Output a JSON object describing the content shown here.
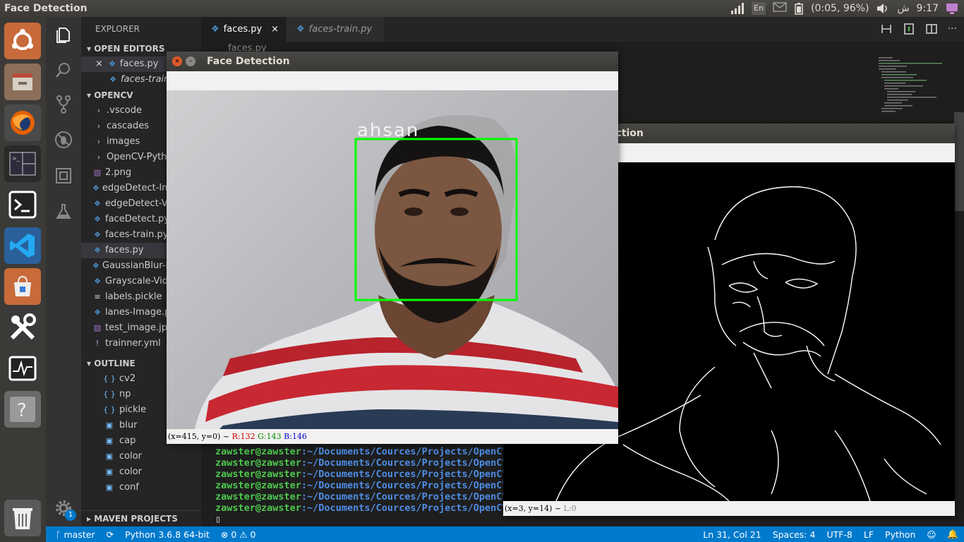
{
  "topbar": {
    "app_title": "Face Detection",
    "lang": "En",
    "battery": "(0:05, 96%)",
    "time_label": "ش",
    "time": "9:17"
  },
  "launcher": {
    "items": [
      "ubuntu-logo-icon",
      "file-manager-icon",
      "firefox-icon",
      "terminal-split-icon",
      "terminal-icon",
      "vscode-icon",
      "software-center-icon",
      "system-tools-icon",
      "system-monitor-icon",
      "help-icon",
      "trash-icon"
    ]
  },
  "activity": {
    "badge": "1"
  },
  "sidebar": {
    "title": "EXPLORER",
    "open_editors_title": "OPEN EDITORS",
    "open_editors": [
      {
        "close": "×",
        "name": "faces.py"
      },
      {
        "name": "faces-train.py"
      }
    ],
    "project_title": "OPENCV",
    "folders": [
      ".vscode",
      "cascades",
      "images",
      "OpenCV-Python"
    ],
    "files": [
      {
        "icon": "img",
        "name": "2.png"
      },
      {
        "icon": "py",
        "name": "edgeDetect-Image.py"
      },
      {
        "icon": "py",
        "name": "edgeDetect-Video.py"
      },
      {
        "icon": "py",
        "name": "faceDetect.py"
      },
      {
        "icon": "py",
        "name": "faces-train.py"
      },
      {
        "icon": "py",
        "name": "faces.py",
        "selected": true
      },
      {
        "icon": "py",
        "name": "GaussianBlur-Image.py"
      },
      {
        "icon": "py",
        "name": "Grayscale-Vid.py"
      },
      {
        "icon": "txt",
        "name": "labels.pickle"
      },
      {
        "icon": "py",
        "name": "lanes-Image.py"
      },
      {
        "icon": "img",
        "name": "test_image.jpg"
      },
      {
        "icon": "yml",
        "name": "trainner.yml"
      }
    ],
    "outline_title": "OUTLINE",
    "outline": [
      {
        "icon": "{ }",
        "name": "cv2"
      },
      {
        "icon": "{ }",
        "name": "np"
      },
      {
        "icon": "{ }",
        "name": "pickle"
      },
      {
        "icon": "▣",
        "name": "blur"
      },
      {
        "icon": "▣",
        "name": "cap"
      },
      {
        "icon": "▣",
        "name": "color"
      },
      {
        "icon": "▣",
        "name": "color"
      },
      {
        "icon": "▣",
        "name": "conf"
      }
    ],
    "maven_title": "MAVEN PROJECTS"
  },
  "tabs": [
    {
      "name": "faces.py",
      "close": "×"
    },
    {
      "name": "faces-train.py"
    }
  ],
  "breadcrumb": "faces.py",
  "terminal": {
    "lines": [
      {
        "user": "zawster@zawster",
        "path": ":~/Documents/Cources/Projects/OpenCV"
      },
      {
        "user": "zawster@zawster",
        "path": ":~/Documents/Cources/Projects/OpenCV"
      },
      {
        "user": "zawster@zawster",
        "path": ":~/Documents/Cources/Projects/OpenCV"
      },
      {
        "user": "zawster@zawster",
        "path": ":~/Documents/Cources/Projects/OpenCV"
      },
      {
        "user": "zawster@zawster",
        "path": ":~/Documents/Cources/Projects/OpenCV"
      },
      {
        "user": "zawster@zawster",
        "path": ":~/Documents/Cources/Projects/OpenCV"
      }
    ],
    "cursor": "▯"
  },
  "statusbar": {
    "branch": "master",
    "python": "Python 3.6.8 64-bit",
    "errors": "0",
    "warnings": "0",
    "position": "Ln 31, Col 21",
    "spaces": "Spaces: 4",
    "encoding": "UTF-8",
    "eol": "LF",
    "language": "Python"
  },
  "face_window": {
    "title": "Face Detection",
    "label": "ahsan",
    "status_coords": "(x=415, y=0) ~",
    "r": "R:132",
    "g": "G:143",
    "b": "B:146"
  },
  "edge_window": {
    "title_partial": "ection",
    "status": "(x=3, y=14) ~",
    "l": "L:0"
  },
  "colors": {
    "accent": "#007acc",
    "detect_box": "#00ff00"
  }
}
